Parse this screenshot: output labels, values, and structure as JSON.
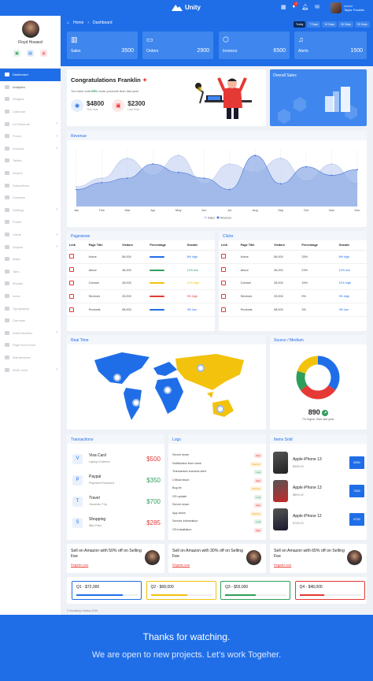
{
  "brand": {
    "name": "Unity"
  },
  "header": {
    "notif_count": "7",
    "user_role": "Admin",
    "user_name": "Taylor Franklin"
  },
  "sidebar": {
    "user_name": "Floyd Howard",
    "items": [
      {
        "label": "Dashboard",
        "active": true,
        "arrow": false
      },
      {
        "label": "Analytics",
        "active": false,
        "arrow": false
      },
      {
        "label": "Widgets",
        "active": false,
        "arrow": false
      },
      {
        "label": "Calendar",
        "active": false,
        "arrow": false
      },
      {
        "label": "UI Elements",
        "active": false,
        "arrow": true
      },
      {
        "label": "Forms",
        "active": false,
        "arrow": true
      },
      {
        "label": "Invoices",
        "active": false,
        "arrow": true
      },
      {
        "label": "Tables",
        "active": false,
        "arrow": false
      },
      {
        "label": "Search",
        "active": false,
        "arrow": false
      },
      {
        "label": "Subscribers",
        "active": false,
        "arrow": false
      },
      {
        "label": "Contacts",
        "active": false,
        "arrow": false
      },
      {
        "label": "Settings",
        "active": false,
        "arrow": true
      },
      {
        "label": "Profile",
        "active": false,
        "arrow": false
      },
      {
        "label": "Cards",
        "active": false,
        "arrow": true
      },
      {
        "label": "Graphs",
        "active": false,
        "arrow": true
      },
      {
        "label": "Maps",
        "active": false,
        "arrow": false
      },
      {
        "label": "Tabs",
        "active": false,
        "arrow": false
      },
      {
        "label": "Modals",
        "active": false,
        "arrow": false
      },
      {
        "label": "Icons",
        "active": false,
        "arrow": false
      },
      {
        "label": "Typography",
        "active": false,
        "arrow": false
      },
      {
        "label": "Carousel",
        "active": false,
        "arrow": false
      },
      {
        "label": "Authentication",
        "active": false,
        "arrow": true
      },
      {
        "label": "Page Not Found",
        "active": false,
        "arrow": false
      },
      {
        "label": "Maintenance",
        "active": false,
        "arrow": false
      },
      {
        "label": "Multi Level",
        "active": false,
        "arrow": true
      }
    ]
  },
  "breadcrumb": {
    "home": "Home",
    "current": "Dashboard"
  },
  "ranges": [
    "Today",
    "7 Days",
    "15 Days",
    "30 Days",
    "90 Days"
  ],
  "stats": [
    {
      "label": "Sales",
      "value": "3500"
    },
    {
      "label": "Orders",
      "value": "2900"
    },
    {
      "label": "Invoices",
      "value": "6500"
    },
    {
      "label": "Alerts",
      "value": "1500"
    }
  ],
  "welcome": {
    "title": "Congratulations Franklin",
    "text_pre": "You have sold ",
    "pct": "65%",
    "text_post": " more products than last year.",
    "v1": "$4800",
    "v1_label": "This Year",
    "v2": "$2300",
    "v2_label": "Last Year"
  },
  "overall": {
    "title": "Overall Sales"
  },
  "revenue": {
    "title": "Revenue",
    "legend": [
      "Sales",
      "Revenue"
    ]
  },
  "chart_data": {
    "type": "area",
    "title": "Revenue",
    "categories": [
      "Jan",
      "Feb",
      "Mar",
      "Apr",
      "May",
      "Jun",
      "Jul",
      "Aug",
      "Sep",
      "Oct",
      "Nov",
      "Dec"
    ],
    "series": [
      {
        "name": "Sales",
        "values": [
          35,
          50,
          85,
          55,
          90,
          40,
          75,
          60,
          85,
          45,
          75,
          40
        ]
      },
      {
        "name": "Revenue",
        "values": [
          30,
          42,
          50,
          75,
          60,
          50,
          30,
          90,
          40,
          70,
          55,
          65
        ]
      }
    ]
  },
  "pageviews": {
    "title": "Pageviews",
    "headers": [
      "Link",
      "Page Title",
      "Visitors",
      "Percentage",
      "Growth"
    ],
    "rows": [
      {
        "page": "Home",
        "visitors": "56,000",
        "pct": 50,
        "color": "#1f6ee8",
        "growth": "8% high",
        "gcolor": "#1f6ee8"
      },
      {
        "page": "About",
        "visitors": "36,000",
        "pct": 20,
        "color": "#2e9e5b",
        "growth": "12% low",
        "gcolor": "#2e9e5b"
      },
      {
        "page": "Contact",
        "visitors": "28,000",
        "pct": 11,
        "color": "#f2c20d",
        "growth": "11% high",
        "gcolor": "#f2c20d"
      },
      {
        "page": "Services",
        "visitors": "33,000",
        "pct": 9,
        "color": "#e53935",
        "growth": "9% high",
        "gcolor": "#e53935"
      },
      {
        "page": "Products",
        "visitors": "98,000",
        "pct": 3,
        "color": "#1f6ee8",
        "growth": "3% low",
        "gcolor": "#1f6ee8"
      }
    ]
  },
  "clicks": {
    "title": "Clicks",
    "headers": [
      "Link",
      "Page Title",
      "Visitors",
      "Percentage",
      "Growth"
    ],
    "rows": [
      {
        "page": "Home",
        "visitors": "56,000",
        "pct": "25%",
        "growth": "8% high"
      },
      {
        "page": "About",
        "visitors": "35,000",
        "pct": "23%",
        "growth": "12% low"
      },
      {
        "page": "Contact",
        "visitors": "28,000",
        "pct": "16%",
        "growth": "11% high"
      },
      {
        "page": "Services",
        "visitors": "33,000",
        "pct": "9%",
        "growth": "9% high"
      },
      {
        "page": "Products",
        "visitors": "98,000",
        "pct": "3%",
        "growth": "3% low"
      }
    ]
  },
  "realtime": {
    "title": "Real Time"
  },
  "source": {
    "title": "Source / Medium",
    "value": "890",
    "caption": "7% higher than last year.",
    "slices": [
      {
        "value": 35,
        "color": "#1f6ee8"
      },
      {
        "value": 30,
        "color": "#e53935"
      },
      {
        "value": 15,
        "color": "#2e9e5b"
      },
      {
        "value": 20,
        "color": "#f2c20d"
      }
    ]
  },
  "transactions": {
    "title": "Transactions",
    "items": [
      {
        "name": "Visa Card",
        "sub": "Laptop Ordered",
        "amount": "$500",
        "color": "#e53935",
        "icon": "V"
      },
      {
        "name": "Paypal",
        "sub": "Payment Received",
        "amount": "$350",
        "color": "#2e9e5b",
        "icon": "P"
      },
      {
        "name": "Travel",
        "sub": "Yosemite Trip",
        "amount": "$700",
        "color": "#2e9e5b",
        "icon": "T"
      },
      {
        "name": "Shopping",
        "sub": "Bills Paid",
        "amount": "$285",
        "color": "#e53935",
        "icon": "S"
      }
    ]
  },
  "logs": {
    "title": "Logs",
    "items": [
      {
        "text": "Server down",
        "tag": "High",
        "tc": "#e53935"
      },
      {
        "text": "Notification from bank",
        "tag": "Medium",
        "tc": "#f2a60d"
      },
      {
        "text": "Transaction success alert",
        "tag": "Low",
        "tc": "#2e9e5b"
      },
      {
        "text": "Critical issue",
        "tag": "High",
        "tc": "#e53935"
      },
      {
        "text": "Bug fix",
        "tag": "Medium",
        "tc": "#f2a60d"
      },
      {
        "text": "OS update",
        "tag": "Low",
        "tc": "#2e9e5b"
      },
      {
        "text": "Server down",
        "tag": "High",
        "tc": "#e53935"
      },
      {
        "text": "App down",
        "tag": "Medium",
        "tc": "#f2a60d"
      },
      {
        "text": "Service information",
        "tag": "Low",
        "tc": "#2e9e5b"
      },
      {
        "text": "OS installation",
        "tag": "High",
        "tc": "#e53935"
      }
    ]
  },
  "items_sold": {
    "title": "Items Sold",
    "items": [
      {
        "name": "Apple iPhone 13",
        "price": "$999.00",
        "qty": "8250",
        "pc": "#222"
      },
      {
        "name": "Apple iPhone 13",
        "price": "$899.00",
        "qty": "7650",
        "pc": "#c62828"
      },
      {
        "name": "Apple iPhone 12",
        "price": "$799.00",
        "qty": "6750",
        "pc": "#1a1a2e"
      }
    ]
  },
  "promos": [
    {
      "text": "Sell on Amazon with 50% off on Selling Fee",
      "link": "Register now"
    },
    {
      "text": "Sell on Amazon with 30% off on Selling Fee",
      "link": "Register now"
    },
    {
      "text": "Sell on Amazon with 65% off on Selling Fee",
      "link": "Register now"
    }
  ],
  "quarters": [
    {
      "label": "Q1 - $72,000",
      "color": "#1f6ee8",
      "pct": 75
    },
    {
      "label": "Q2 - $68,000",
      "color": "#f2c20d",
      "pct": 60
    },
    {
      "label": "Q3 - $55,000",
      "color": "#2e9e5b",
      "pct": 50
    },
    {
      "label": "Q4 - $48,000",
      "color": "#e53935",
      "pct": 40
    }
  ],
  "copyright": "© Bootstrap Gallery 2024",
  "footer": {
    "line1": "Thanks for watching.",
    "line2": "We are open to new projects. Let’s work Togeher."
  }
}
